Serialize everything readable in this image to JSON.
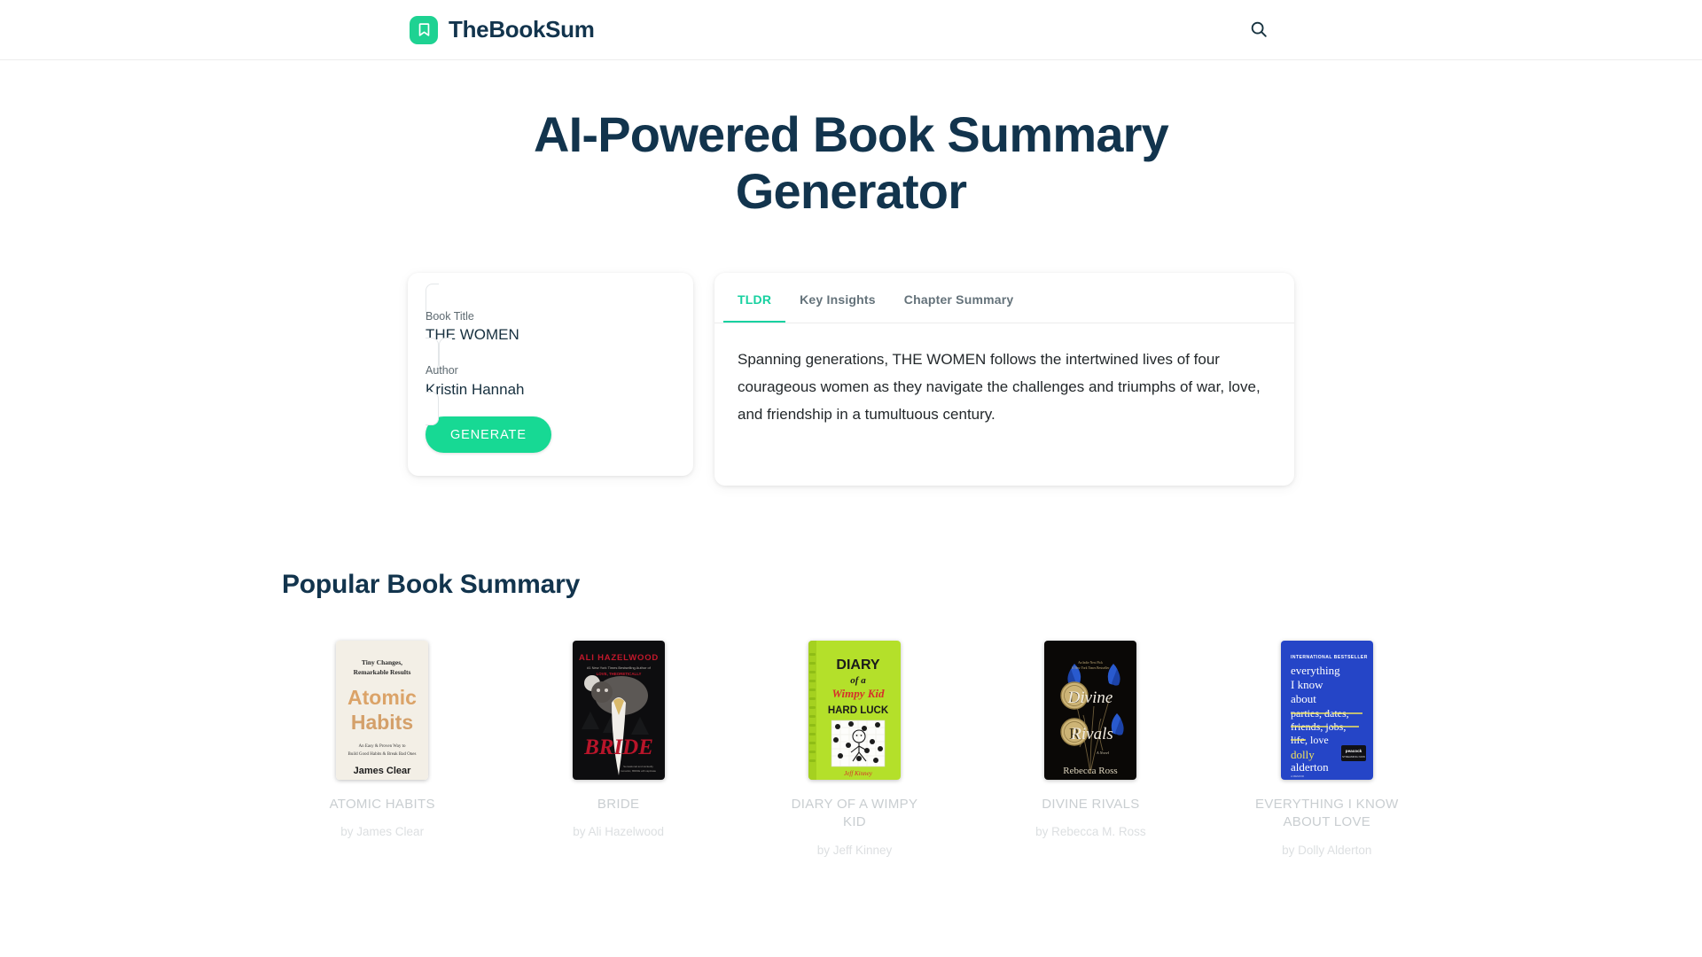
{
  "header": {
    "brand_name": "TheBookSum",
    "logo_icon": "bookmark-icon",
    "search_icon": "search-icon",
    "accent_color": "#1ed292",
    "brand_color": "#12344d"
  },
  "hero": {
    "title": "AI-Powered Book Summary Generator"
  },
  "form": {
    "title_field": {
      "label": "Book Title",
      "value": "THE WOMEN",
      "placeholder": "Book Title"
    },
    "author_field": {
      "label": "Author",
      "value": "Kristin Hannah",
      "placeholder": "Author"
    },
    "generate_label": "GENERATE",
    "button_color": "#17d994"
  },
  "result": {
    "tabs": [
      {
        "label": "TLDR",
        "active": true
      },
      {
        "label": "Key Insights",
        "active": false
      },
      {
        "label": "Chapter Summary",
        "active": false
      }
    ],
    "active_tab_color": "#17d1a0",
    "summary": "Spanning generations, THE WOMEN follows the intertwined lives of four courageous women as they navigate the challenges and triumphs of war, love, and friendship in a tumultuous century."
  },
  "popular": {
    "heading": "Popular Book Summary",
    "books": [
      {
        "title": "ATOMIC HABITS",
        "author": "by James Clear",
        "cover": {
          "style": "atomic",
          "bg": "#f3efe6",
          "tagline": "Tiny Changes, Remarkable Results",
          "main_title": "Atomic Habits",
          "subtitle": "An Easy & Proven Way to Build Good Habits & Break Bad Ones",
          "author_line": "James Clear",
          "title_color": "#d9a263"
        }
      },
      {
        "title": "BRIDE",
        "author": "by Ali Hazelwood",
        "cover": {
          "style": "bride",
          "bg": "#0d0d0f",
          "tagline": "ALI HAZELWOOD",
          "subtagline": "#1 New York Times Bestselling Author of LOVE, THEORETICALLY",
          "main_title": "BRIDE",
          "title_color": "#c2182b"
        }
      },
      {
        "title": "DIARY OF A WIMPY KID",
        "author": "by Jeff Kinney",
        "cover": {
          "style": "wimpy",
          "bg": "#b4e02a",
          "line1": "DIARY",
          "line2": "of a",
          "line3": "Wimpy Kid",
          "line4": "HARD LUCK",
          "author_line": "Jeff Kinney",
          "title_color": "#1b1b1b"
        }
      },
      {
        "title": "DIVINE RIVALS",
        "author": "by Rebecca M. Ross",
        "cover": {
          "style": "divine",
          "bg": "#0a0806",
          "line1": "Divine",
          "line2": "Rivals",
          "subtitle": "A Novel",
          "author_line": "Rebecca Ross",
          "title_color": "#f2ede2",
          "accent": "#2b5fd9"
        }
      },
      {
        "title": "EVERYTHING I KNOW ABOUT LOVE",
        "author": "by Dolly Alderton",
        "cover": {
          "style": "everything",
          "bg": "#2545c7",
          "banner": "INTERNATIONAL BESTSELLER",
          "l1": "everything",
          "l2": "I know",
          "l3": "about",
          "l4": "parties, dates,",
          "l5": "friends, jobs,",
          "l6": "life, love",
          "l7": "dolly",
          "l8": "alderton",
          "memoir": "A MEMOIR",
          "badge": "peacock",
          "title_color": "#ffffff",
          "accent": "#f2e35c"
        }
      }
    ]
  }
}
